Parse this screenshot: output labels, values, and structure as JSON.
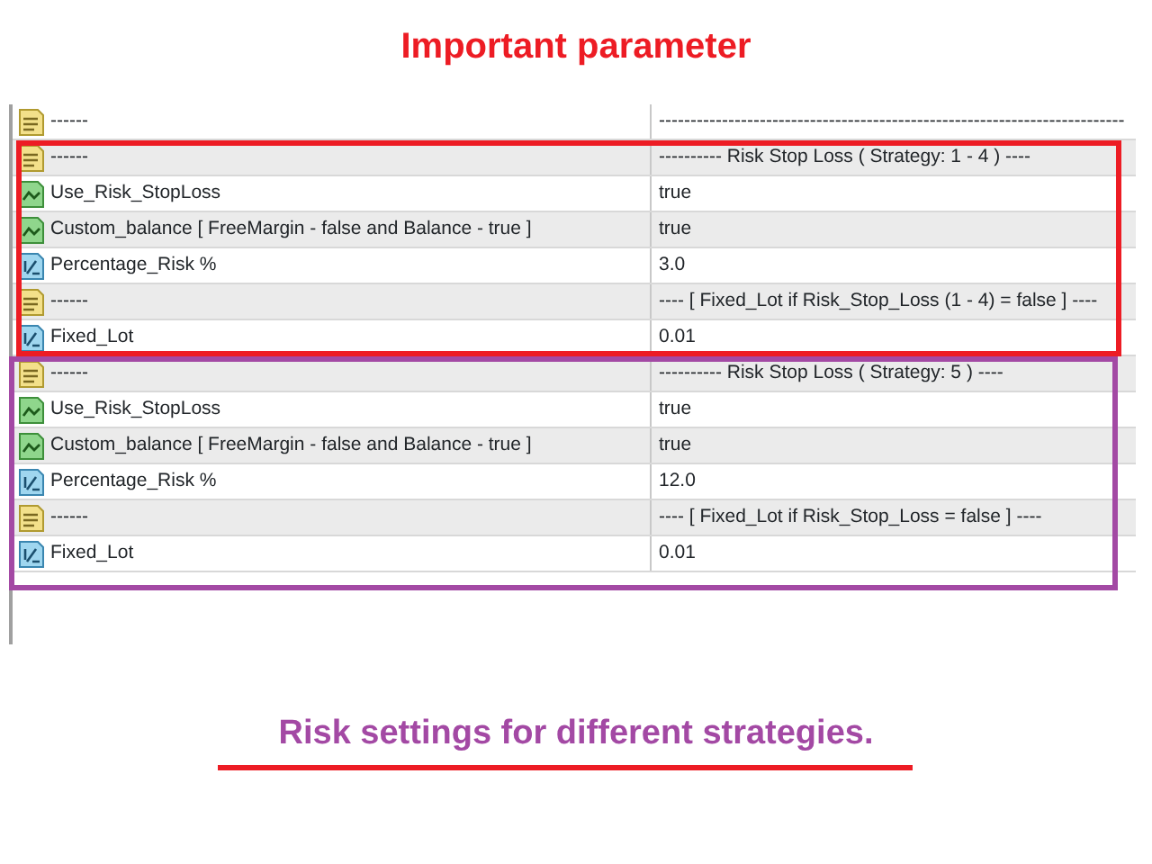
{
  "heading": "Important parameter",
  "table": {
    "rows": [
      {
        "kind": "string",
        "name": "------",
        "value": "--------------------------------------------------------------------------"
      }
    ]
  },
  "highlights": [
    {
      "color": "#ed1c24",
      "rows": [
        {
          "kind": "string",
          "name": "------",
          "value": "---------- Risk Stop Loss ( Strategy: 1 - 4 ) ----"
        },
        {
          "kind": "bool",
          "name": "Use_Risk_StopLoss",
          "value": "true"
        },
        {
          "kind": "bool",
          "name": "Custom_balance [ FreeMargin - false and Balance - true ]",
          "value": "true"
        },
        {
          "kind": "double",
          "name": "Percentage_Risk %",
          "value": "3.0"
        },
        {
          "kind": "string",
          "name": "------",
          "value": "---- [ Fixed_Lot if Risk_Stop_Loss (1 - 4) = false ] ----"
        },
        {
          "kind": "double",
          "name": "Fixed_Lot",
          "value": "0.01"
        }
      ]
    },
    {
      "color": "#a349a4",
      "rows": [
        {
          "kind": "string",
          "name": "------",
          "value": "---------- Risk Stop Loss ( Strategy: 5 ) ----"
        },
        {
          "kind": "bool",
          "name": "Use_Risk_StopLoss",
          "value": "true"
        },
        {
          "kind": "bool",
          "name": "Custom_balance [ FreeMargin - false and Balance - true ]",
          "value": "true"
        },
        {
          "kind": "double",
          "name": "Percentage_Risk %",
          "value": "12.0"
        },
        {
          "kind": "string",
          "name": "------",
          "value": "---- [ Fixed_Lot if Risk_Stop_Loss = false ] ----"
        },
        {
          "kind": "double",
          "name": "Fixed_Lot",
          "value": "0.01"
        }
      ]
    }
  ],
  "caption": "Risk settings for different strategies."
}
